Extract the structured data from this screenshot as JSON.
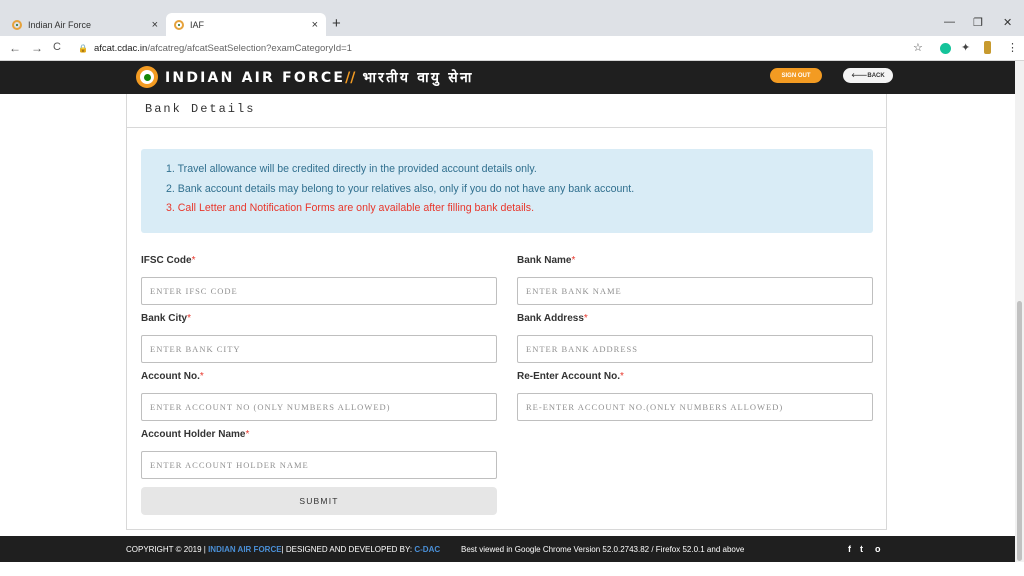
{
  "browser": {
    "tabs": [
      {
        "title": "Indian Air Force",
        "close": "×"
      },
      {
        "title": "IAF",
        "close": "×"
      }
    ],
    "new_tab": "+",
    "window": {
      "minimize": "—",
      "restore": "❐",
      "close": "✕"
    },
    "nav": {
      "back": "←",
      "forward": "→",
      "reload": "C"
    },
    "url_host": "afcat.cdac.in",
    "url_path": "/afcatreg/afcatSeatSelection?examCategoryId=1",
    "icons": [
      "star-icon",
      "grammarly-icon",
      "extensions-icon",
      "profile-icon",
      "menu-icon"
    ]
  },
  "header": {
    "brand_en": "INDIAN AIR FORCE",
    "brand_sep": "//",
    "brand_hi": "भारतीय वायु सेना",
    "signout": "SIGN OUT",
    "back": "BACK",
    "accent": "#f39b22"
  },
  "card": {
    "title": "Bank Details",
    "notices": [
      "1. Travel allowance will be credited directly in the provided account details only.",
      "2. Bank account details may belong to your relatives also, only if you do not have any bank account.",
      "3. Call Letter and Notification Forms are only available after filling bank details."
    ]
  },
  "form": {
    "ifsc": {
      "label": "IFSC Code",
      "placeholder": "ENTER IFSC CODE"
    },
    "bank_name": {
      "label": "Bank Name",
      "placeholder": "ENTER BANK NAME"
    },
    "bank_city": {
      "label": "Bank City",
      "placeholder": "ENTER BANK CITY"
    },
    "bank_address": {
      "label": "Bank Address",
      "placeholder": "ENTER BANK ADDRESS"
    },
    "account_no": {
      "label": "Account No.",
      "placeholder": "ENTER ACCOUNT NO (ONLY NUMBERS ALLOWED)"
    },
    "reenter_account_no": {
      "label": "Re-Enter Account No.",
      "placeholder": "RE-ENTER ACCOUNT NO.(ONLY NUMBERS ALLOWED)"
    },
    "holder_name": {
      "label": "Account Holder Name",
      "placeholder": "ENTER ACCOUNT HOLDER NAME"
    },
    "required_mark": "*",
    "submit": "SUBMIT"
  },
  "footer": {
    "copyright": "COPYRIGHT © 2019 | ",
    "iaf": "INDIAN AIR FORCE",
    "designed": "| DESIGNED AND DEVELOPED BY: ",
    "cdac": "C-DAC",
    "best_viewed": "Best viewed in Google Chrome Version 52.0.2743.82 / Firefox 52.0.1 and above",
    "social": [
      "f",
      "t",
      "o"
    ]
  }
}
